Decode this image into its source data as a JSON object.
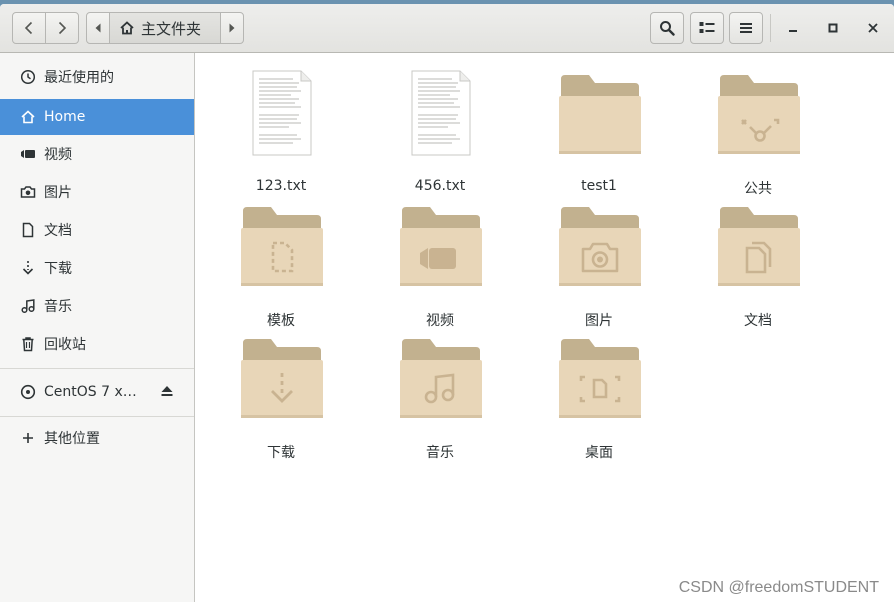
{
  "header": {
    "breadcrumb": "主文件夹"
  },
  "sidebar": {
    "recent": "最近使用的",
    "home": "Home",
    "videos": "视频",
    "pictures": "图片",
    "documents": "文档",
    "downloads": "下载",
    "music": "音乐",
    "trash": "回收站",
    "device": "CentOS 7 x…",
    "other": "其他位置"
  },
  "files": [
    {
      "name": "123.txt",
      "kind": "text-file"
    },
    {
      "name": "456.txt",
      "kind": "text-file"
    },
    {
      "name": "test1",
      "kind": "folder"
    },
    {
      "name": "公共",
      "kind": "folder-public"
    },
    {
      "name": "模板",
      "kind": "folder-templates"
    },
    {
      "name": "视频",
      "kind": "folder-videos"
    },
    {
      "name": "图片",
      "kind": "folder-pictures"
    },
    {
      "name": "文档",
      "kind": "folder-documents"
    },
    {
      "name": "下载",
      "kind": "folder-downloads"
    },
    {
      "name": "音乐",
      "kind": "folder-music"
    },
    {
      "name": "桌面",
      "kind": "folder-desktop"
    }
  ],
  "colors": {
    "accent": "#4a90d9",
    "folder_back": "#c2b18f",
    "folder_front": "#e8d6b8",
    "folder_emblem": "#c9b391"
  },
  "watermark": "CSDN @freedomSTUDENT"
}
